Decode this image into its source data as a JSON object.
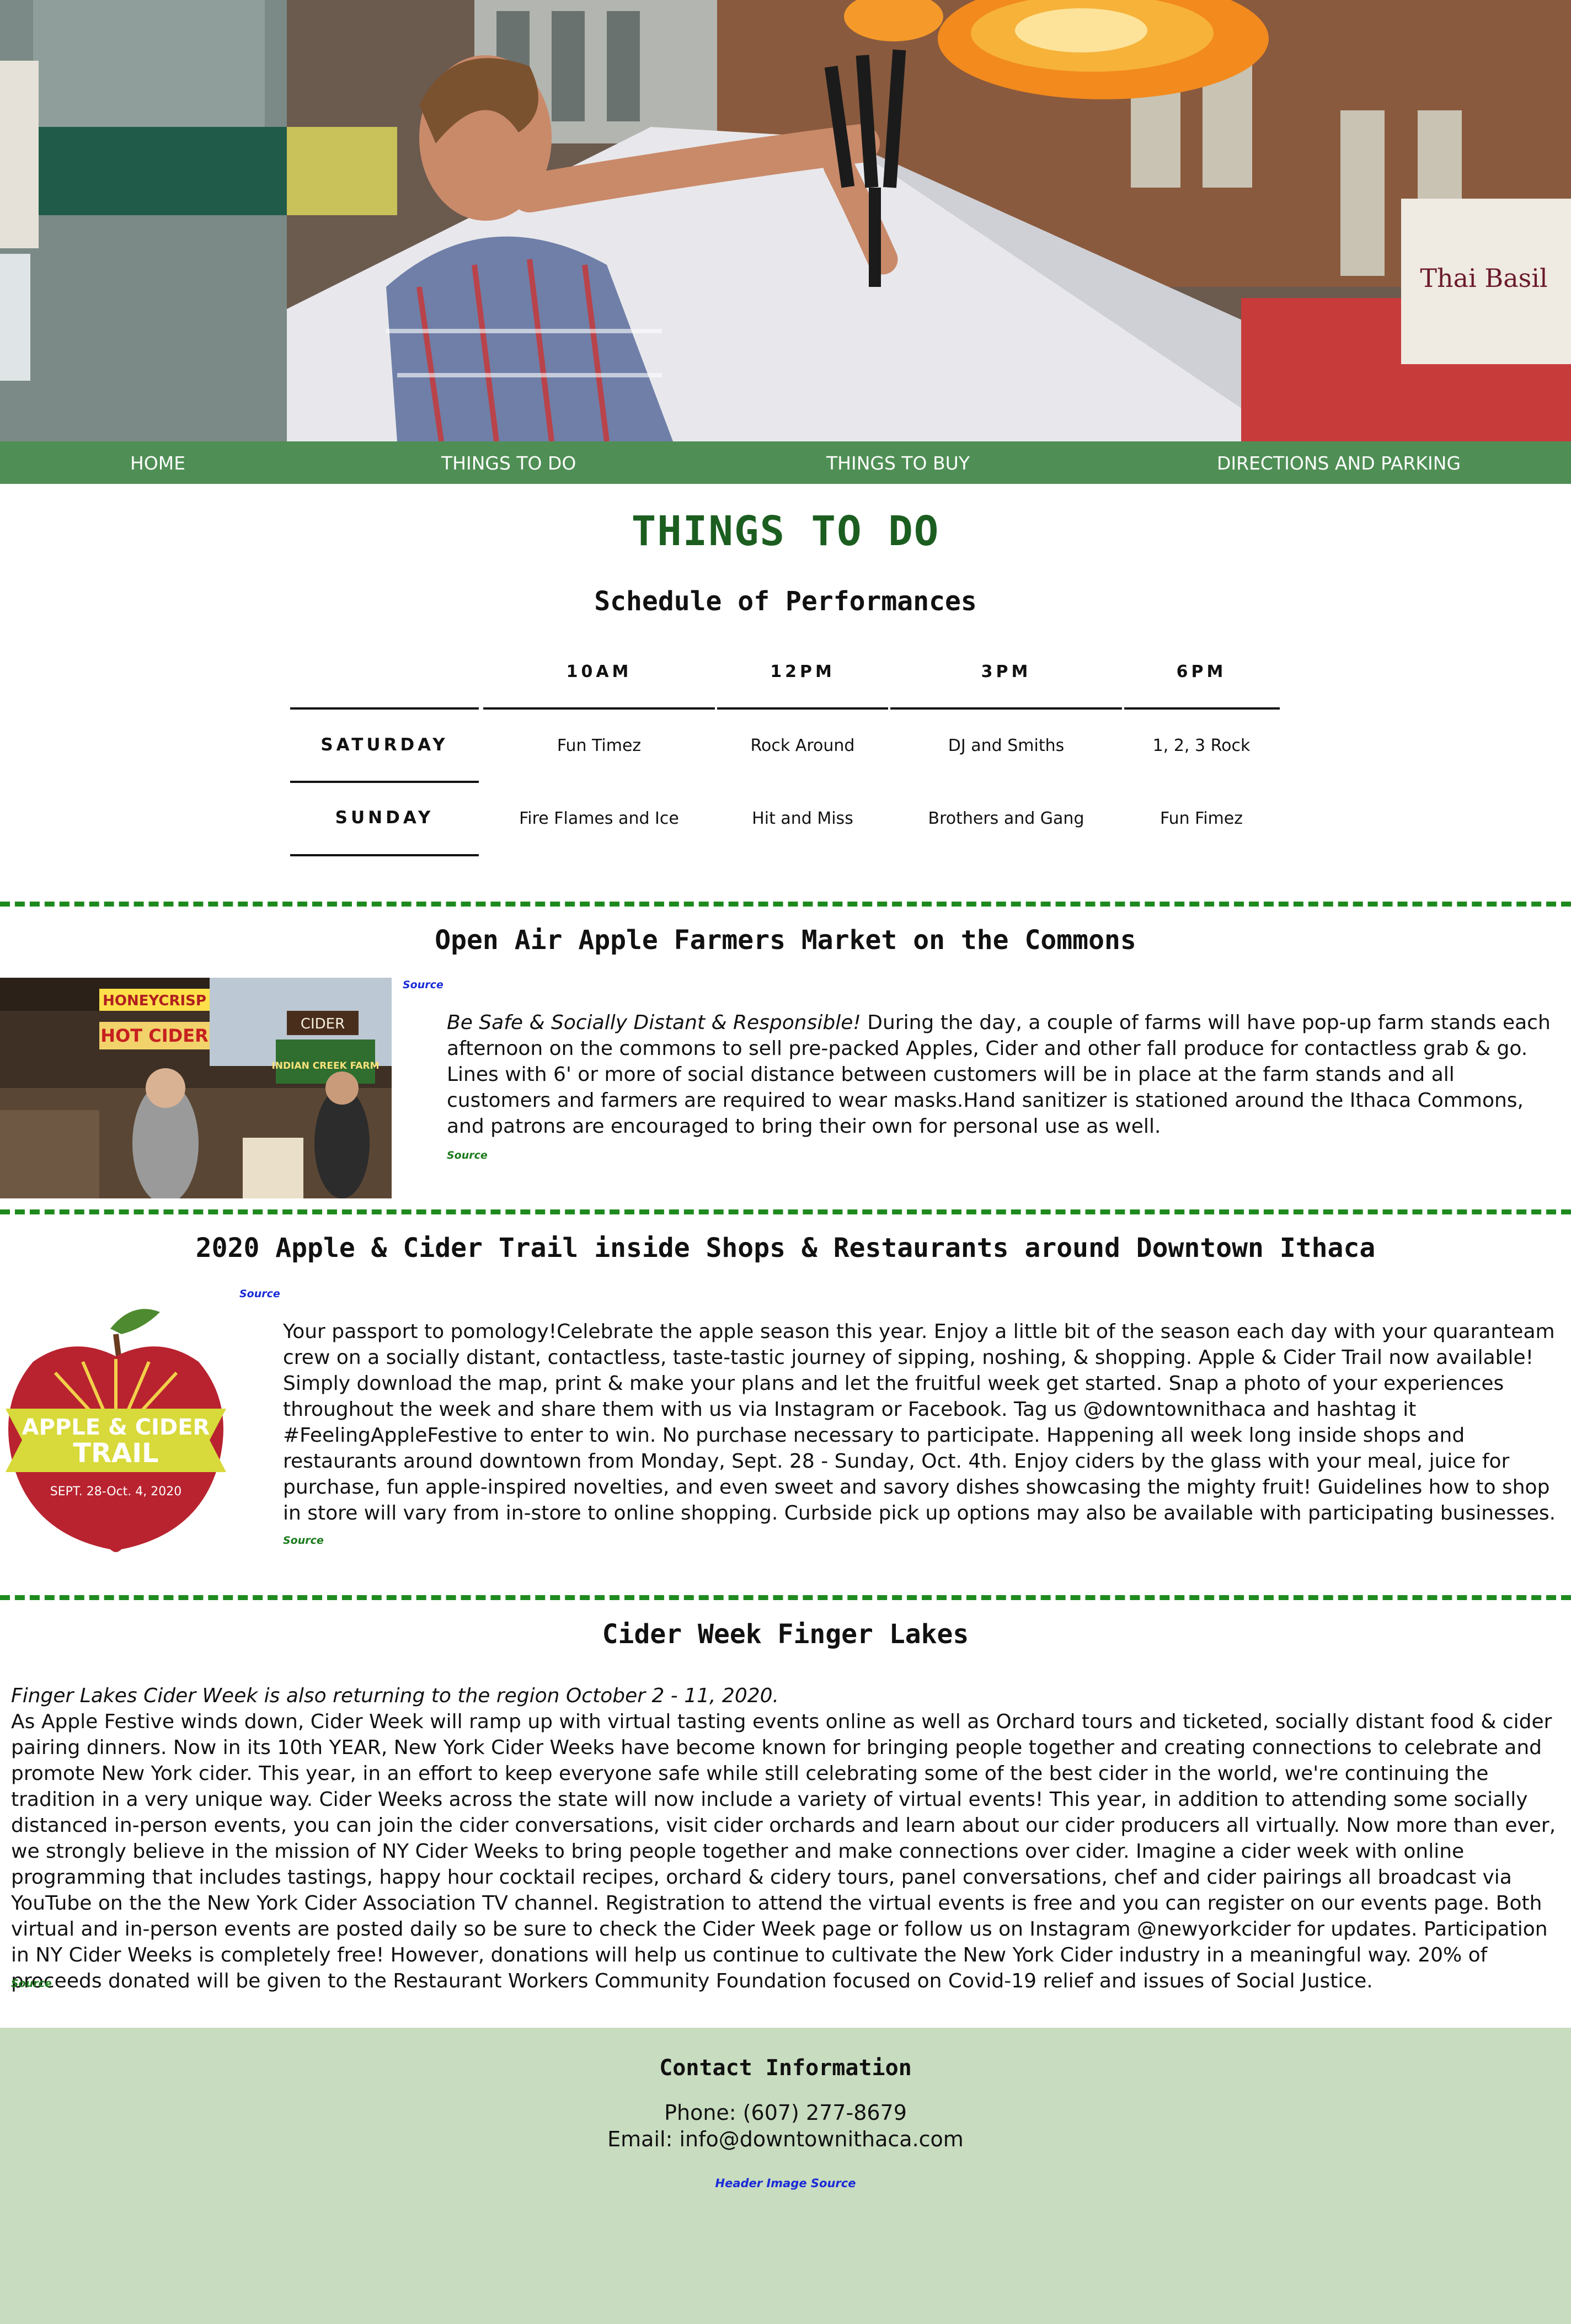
{
  "nav": {
    "items": [
      {
        "label": "HOME"
      },
      {
        "label": "THINGS TO DO"
      },
      {
        "label": "THINGS TO BUY"
      },
      {
        "label": "DIRECTIONS AND PARKING"
      }
    ]
  },
  "page_title": "THINGS TO DO",
  "schedule": {
    "title": "Schedule of Performances",
    "columns": [
      "10AM",
      "12PM",
      "3PM",
      "6PM"
    ],
    "rows": [
      {
        "day": "SATURDAY",
        "acts": [
          "Fun Timez",
          "Rock Around",
          "DJ and Smiths",
          "1, 2, 3 Rock"
        ]
      },
      {
        "day": "SUNDAY",
        "acts": [
          "Fire Flames and Ice",
          "Hit and Miss",
          "Brothers and Gang",
          "Fun Fimez"
        ]
      }
    ]
  },
  "market": {
    "title": "Open Air Apple Farmers Market on the Commons",
    "image_source_label": "Source",
    "lead": "Be Safe & Socially Distant & Responsible!",
    "text": " During the day, a couple of farms will have pop-up farm stands each afternoon on the commons to sell pre-packed Apples, Cider and other fall produce for contactless grab & go. Lines with 6' or more of social distance between customers will be in place at the farm stands and all customers and farmers are required to wear masks.Hand sanitizer is stationed around the Ithaca Commons, and patrons are encouraged to bring their own for personal use as well.",
    "text_source_label": "Source",
    "image_signs": [
      "HONEYCRISP",
      "HOT CIDER",
      "CIDER",
      "INDIAN CREEK FARM"
    ]
  },
  "trail": {
    "title": "2020 Apple & Cider Trail inside Shops & Restaurants around Downtown Ithaca",
    "image_source_label": "Source",
    "logo_line1": "APPLE & CIDER",
    "logo_line2": "TRAIL",
    "logo_dates": "SEPT. 28-Oct. 4, 2020",
    "text": "Your passport to pomology!Celebrate the apple season this year. Enjoy a little bit of the season each day with your quaranteam crew on a socially distant, contactless, taste-tastic journey of sipping, noshing, & shopping. Apple & Cider Trail now available! Simply download the map, print & make your plans and let the fruitful week get started. Snap a photo of your experiences throughout the week and share them with us via Instagram or Facebook. Tag us @downtownithaca and hashtag it #FeelingAppleFestive to enter to win. No purchase necessary to participate. Happening all week long inside shops and restaurants around downtown from Monday, Sept. 28 - Sunday, Oct. 4th. Enjoy ciders by the glass with your meal, juice for purchase, fun apple-inspired novelties, and even sweet and savory dishes showcasing the mighty fruit! Guidelines how to shop in store will vary from in-store to online shopping. Curbside pick up options may also be available with participating businesses.",
    "text_source_label": "Source"
  },
  "cider_week": {
    "title": "Cider Week Finger Lakes",
    "lead": "Finger Lakes Cider Week is also returning to the region October 2 - 11, 2020.",
    "text": "As Apple Festive winds down, Cider Week will ramp up with virtual tasting events online as well as Orchard tours and ticketed, socially distant food & cider pairing dinners. Now in its 10th YEAR, New York Cider Weeks have become known for bringing people together and creating connections to celebrate and promote New York cider. This year, in an effort to keep everyone safe while still celebrating some of the best cider in the world, we're continuing the tradition in a very unique way. Cider Weeks across the state will now include a variety of virtual events! This year, in addition to attending some socially distanced in-person events, you can join the cider conversations, visit cider orchards and learn about our cider producers all virtually. Now more than ever, we strongly believe in the mission of NY Cider Weeks to bring people together and make connections over cider. Imagine a cider week with online programming that includes tastings, happy hour cocktail recipes, orchard & cidery tours, panel conversations, chef and cider pairings all broadcast via YouTube on the the New York Cider Association TV channel. Registration to attend the virtual events is free and you can register on our events page. Both virtual and in-person events are posted daily so be sure to check the Cider Week page or follow us on Instagram @newyorkcider for updates. Participation in NY Cider Weeks is completely free! However, donations will help us continue to cultivate the New York Cider industry in a meaningful way. 20% of proceeds donated will be given to the Restaurant Workers Community Foundation focused on Covid-19 relief and issues of Social Justice.",
    "text_source_label": "Source"
  },
  "hero": {
    "sign_text": "Thai Basil"
  },
  "footer": {
    "title": "Contact Information",
    "phone": "Phone: (607) 277-8679",
    "email": "Email: info@downtownithaca.com",
    "header_image_source": "Header Image Source"
  },
  "colors": {
    "nav_bg": "#4f8f55",
    "title_green": "#1b5e20",
    "divider_green": "#1e8a1e",
    "footer_bg": "#c8dcc0",
    "link_blue": "#1a2bd6"
  }
}
